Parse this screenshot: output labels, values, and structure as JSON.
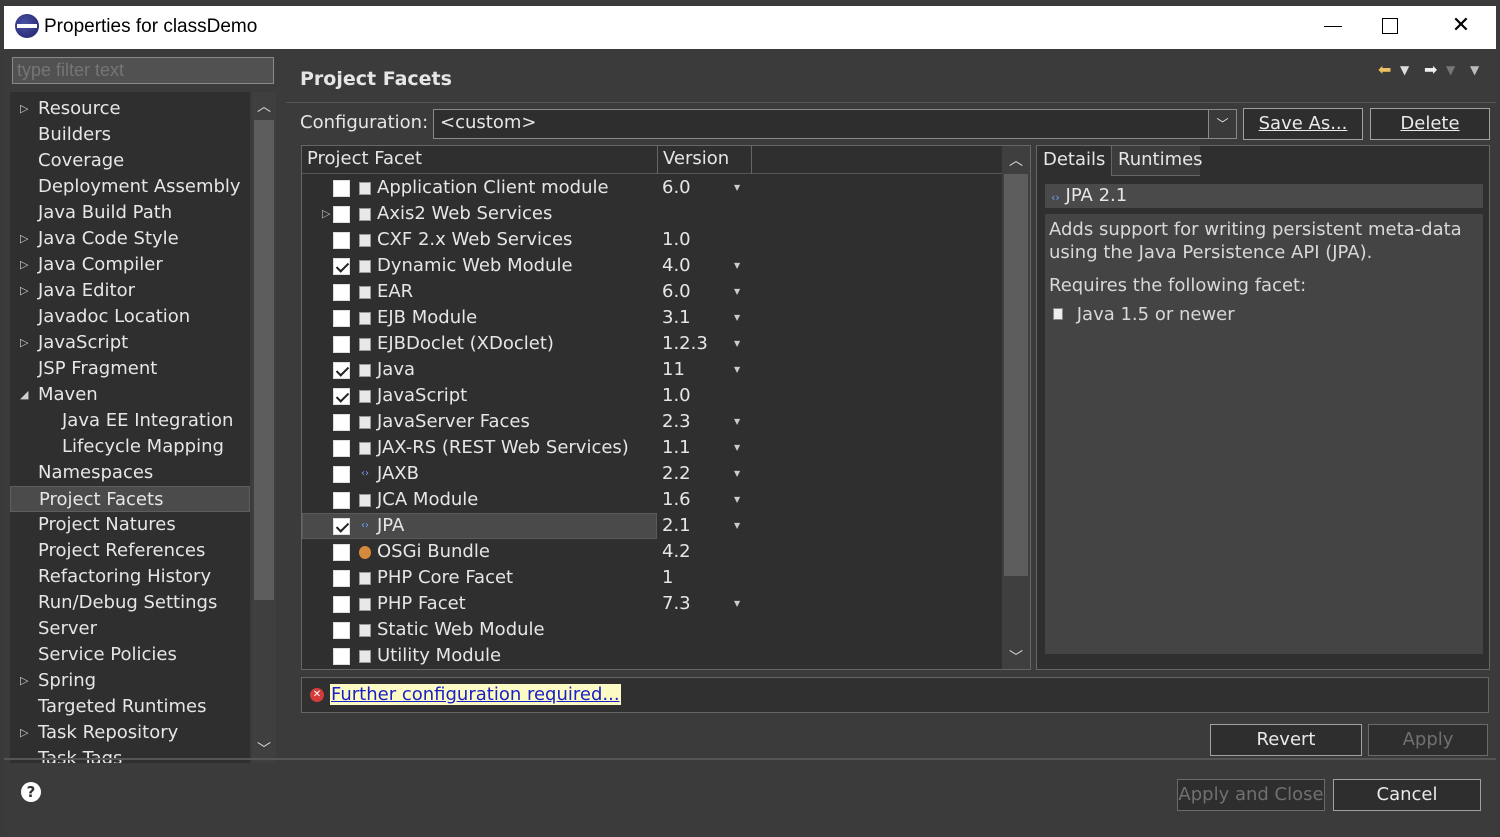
{
  "window": {
    "title": "Properties for classDemo"
  },
  "filter": {
    "placeholder": "type filter text"
  },
  "tree": {
    "items": [
      {
        "label": "Resource",
        "expandable": true
      },
      {
        "label": "Builders"
      },
      {
        "label": "Coverage"
      },
      {
        "label": "Deployment Assembly"
      },
      {
        "label": "Java Build Path"
      },
      {
        "label": "Java Code Style",
        "expandable": true
      },
      {
        "label": "Java Compiler",
        "expandable": true
      },
      {
        "label": "Java Editor",
        "expandable": true
      },
      {
        "label": "Javadoc Location"
      },
      {
        "label": "JavaScript",
        "expandable": true
      },
      {
        "label": "JSP Fragment"
      },
      {
        "label": "Maven",
        "expanded": true
      },
      {
        "label": "Java EE Integration",
        "child": true
      },
      {
        "label": "Lifecycle Mapping",
        "child": true
      },
      {
        "label": "Namespaces"
      },
      {
        "label": "Project Facets",
        "selected": true
      },
      {
        "label": "Project Natures"
      },
      {
        "label": "Project References"
      },
      {
        "label": "Refactoring History"
      },
      {
        "label": "Run/Debug Settings"
      },
      {
        "label": "Server"
      },
      {
        "label": "Service Policies"
      },
      {
        "label": "Spring",
        "expandable": true
      },
      {
        "label": "Targeted Runtimes"
      },
      {
        "label": "Task Repository",
        "expandable": true
      },
      {
        "label": "Task Tags"
      }
    ]
  },
  "page": {
    "title": "Project Facets",
    "config_label": "Configuration:",
    "config_value": "<custom>",
    "save_as": "Save As...",
    "delete": "Delete"
  },
  "facets": {
    "header_facet": "Project Facet",
    "header_version": "Version",
    "rows": [
      {
        "name": "Application Client module",
        "version": "6.0",
        "checked": false,
        "dropdown": true
      },
      {
        "name": "Axis2 Web Services",
        "version": "",
        "checked": false,
        "expandable": true
      },
      {
        "name": "CXF 2.x Web Services",
        "version": "1.0",
        "checked": false
      },
      {
        "name": "Dynamic Web Module",
        "version": "4.0",
        "checked": true,
        "dropdown": true
      },
      {
        "name": "EAR",
        "version": "6.0",
        "checked": false,
        "dropdown": true
      },
      {
        "name": "EJB Module",
        "version": "3.1",
        "checked": false,
        "dropdown": true
      },
      {
        "name": "EJBDoclet (XDoclet)",
        "version": "1.2.3",
        "checked": false,
        "dropdown": true
      },
      {
        "name": "Java",
        "version": "11",
        "checked": true,
        "dropdown": true
      },
      {
        "name": "JavaScript",
        "version": "1.0",
        "checked": true
      },
      {
        "name": "JavaServer Faces",
        "version": "2.3",
        "checked": false,
        "dropdown": true
      },
      {
        "name": "JAX-RS (REST Web Services)",
        "version": "1.1",
        "checked": false,
        "dropdown": true
      },
      {
        "name": "JAXB",
        "version": "2.2",
        "checked": false,
        "dropdown": true,
        "icon": "jaxb"
      },
      {
        "name": "JCA Module",
        "version": "1.6",
        "checked": false,
        "dropdown": true
      },
      {
        "name": "JPA",
        "version": "2.1",
        "checked": true,
        "dropdown": true,
        "selected": true,
        "icon": "jpa"
      },
      {
        "name": "OSGi Bundle",
        "version": "4.2",
        "checked": false,
        "icon": "osgi"
      },
      {
        "name": "PHP Core Facet",
        "version": "1",
        "checked": false
      },
      {
        "name": "PHP Facet",
        "version": "7.3",
        "checked": false,
        "dropdown": true
      },
      {
        "name": "Static Web Module",
        "version": "",
        "checked": false
      },
      {
        "name": "Utility Module",
        "version": "",
        "checked": false
      }
    ]
  },
  "details": {
    "tab_details": "Details",
    "tab_runtimes": "Runtimes",
    "title": "JPA 2.1",
    "description": "Adds support for writing persistent meta-data using the Java Persistence API (JPA).",
    "requires": "Requires the following facet:",
    "requirement": "Java 1.5 or newer"
  },
  "message": {
    "link": "Further configuration required..."
  },
  "buttons": {
    "revert": "Revert",
    "apply": "Apply",
    "apply_close": "Apply and Close",
    "cancel": "Cancel"
  },
  "colors": {
    "background": "#3b3b3b",
    "link": "#1a20c8",
    "link_bg": "#fdfbc4",
    "error": "#d43c3c"
  }
}
